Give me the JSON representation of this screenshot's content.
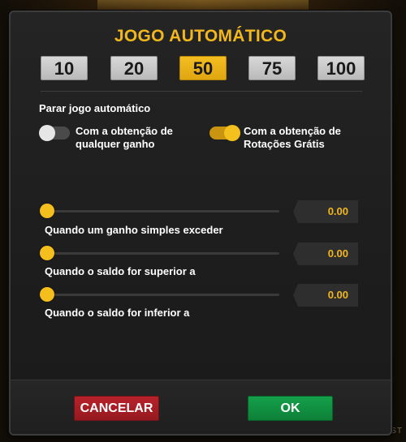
{
  "dialog": {
    "title": "JOGO AUTOMÁTICO",
    "spin_counts": [
      {
        "label": "10",
        "selected": false
      },
      {
        "label": "20",
        "selected": false
      },
      {
        "label": "50",
        "selected": true
      },
      {
        "label": "75",
        "selected": false
      },
      {
        "label": "100",
        "selected": false
      }
    ],
    "stop_section_label": "Parar jogo automático",
    "toggles": [
      {
        "label_line1": "Com a obtenção de",
        "label_line2": "qualquer ganho",
        "on": false
      },
      {
        "label_line1": "Com a obtenção de",
        "label_line2": "Rotações Grátis",
        "on": true
      }
    ],
    "sliders": [
      {
        "label": "Quando um ganho simples exceder",
        "value": "0.00",
        "fraction": 0
      },
      {
        "label": "Quando o saldo for superior a",
        "value": "0.00",
        "fraction": 0
      },
      {
        "label": "Quando o saldo for inferior a",
        "value": "0.00",
        "fraction": 0
      }
    ],
    "cancel_label": "CANCELAR",
    "ok_label": "OK"
  },
  "background": {
    "corner_text": "APOST"
  },
  "colors": {
    "accent": "#f2b71d",
    "cancel": "#b8222a",
    "ok": "#14a04a",
    "panel": "#222222"
  }
}
